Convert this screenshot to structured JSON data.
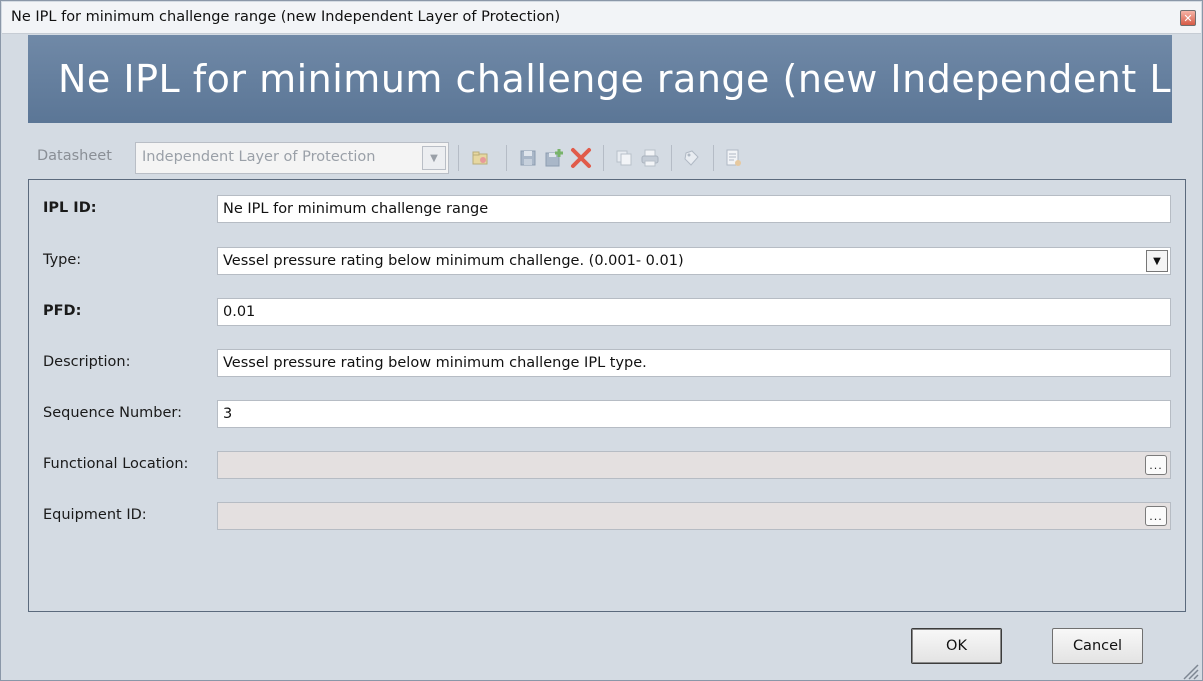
{
  "window": {
    "title": "Ne IPL for minimum challenge range (new Independent Layer of Protection)",
    "close_symbol": "✕"
  },
  "banner": {
    "text": "Ne IPL for minimum challenge range (new Independent Layer..."
  },
  "toolbar": {
    "datasheet_label": "Datasheet",
    "datasheet_value": "Independent Layer of Protection",
    "icons": [
      "open-icon",
      "save-icon",
      "save-new-icon",
      "delete-icon",
      "copy-icon",
      "print-icon",
      "tag-icon",
      "report-icon"
    ]
  },
  "form": {
    "fields": [
      {
        "label": "IPL ID:",
        "value": "Ne IPL for minimum challenge range",
        "bold": true,
        "kind": "text"
      },
      {
        "label": "Type:",
        "value": "Vessel pressure rating below minimum challenge. (0.001- 0.01)",
        "bold": false,
        "kind": "dropdown"
      },
      {
        "label": "PFD:",
        "value": "0.01",
        "bold": true,
        "kind": "text"
      },
      {
        "label": "Description:",
        "value": "Vessel pressure rating below minimum challenge IPL type.",
        "bold": false,
        "kind": "text"
      },
      {
        "label": "Sequence Number:",
        "value": "3",
        "bold": false,
        "kind": "text"
      },
      {
        "label": "Functional Location:",
        "value": "",
        "bold": false,
        "kind": "picker",
        "button": "..."
      },
      {
        "label": "Equipment ID:",
        "value": "",
        "bold": false,
        "kind": "picker",
        "button": "..."
      }
    ]
  },
  "buttons": {
    "ok": "OK",
    "cancel": "Cancel"
  },
  "colors": {
    "banner": "#5b7696",
    "window_bg": "#d4dbe3",
    "delete_red": "#e15b4a"
  }
}
